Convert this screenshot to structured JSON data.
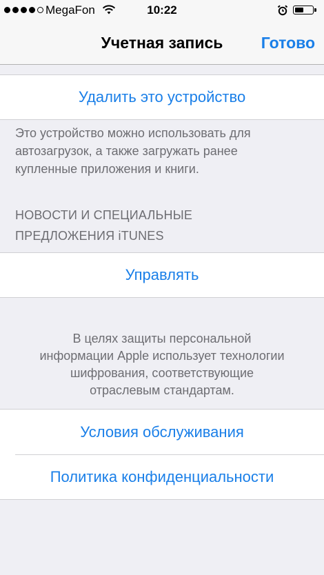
{
  "status_bar": {
    "carrier": "MegaFon",
    "time": "10:22",
    "signal_dots_filled": 4,
    "signal_dots_total": 5,
    "wifi_icon": "wifi-icon",
    "alarm_icon": "alarm-clock-icon",
    "battery_level": 0.5
  },
  "nav": {
    "title": "Учетная запись",
    "done_label": "Готово"
  },
  "device": {
    "remove_label": "Удалить это устройство",
    "footer_line1": "Это устройство можно использовать для",
    "footer_line2": "автозагрузок, а также загружать ранее",
    "footer_line3": "купленные приложения и книги."
  },
  "news": {
    "header_line1": "НОВОСТИ И СПЕЦИАЛЬНЫЕ",
    "header_line2": "ПРЕДЛОЖЕНИЯ iTUNES",
    "manage_label": "Управлять"
  },
  "security": {
    "line1": "В целях защиты персональной",
    "line2": "информации Apple использует технологии",
    "line3": "шифрования, соответствующие",
    "line4": "отраслевым стандартам."
  },
  "legal": {
    "terms_label": "Условия обслуживания",
    "privacy_label": "Политика конфиденциальности"
  },
  "colors": {
    "accent": "#1a7fe8",
    "background": "#efeff4",
    "secondary_text": "#6d6d72"
  }
}
